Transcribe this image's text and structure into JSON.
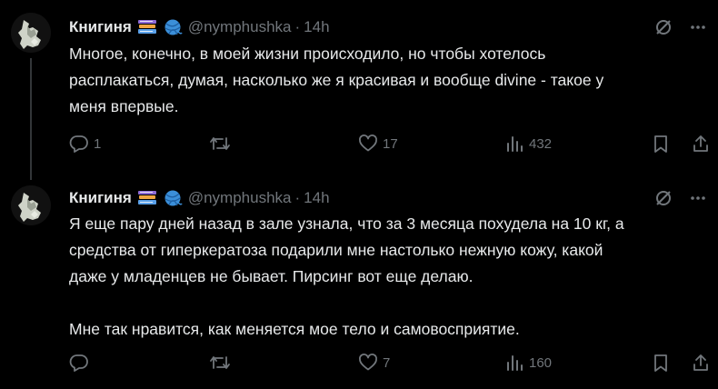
{
  "tweets": [
    {
      "name": "Книгиня",
      "emoji_icons": [
        "books-icon",
        "yarn-ball-icon"
      ],
      "handle": "@nymphushka",
      "separator": "·",
      "time": "14h",
      "text": "Многое, конечно, в моей жизни происходило, но чтобы хотелось\nрасплакаться, думая, насколько же я красивая и вообще divine - такое у\nменя впервые.",
      "actions": {
        "replies": "1",
        "retweets": "",
        "likes": "17",
        "views": "432"
      }
    },
    {
      "name": "Книгиня",
      "emoji_icons": [
        "books-icon",
        "yarn-ball-icon"
      ],
      "handle": "@nymphushka",
      "separator": "·",
      "time": "14h",
      "text": "Я еще пару дней назад в зале узнала, что за 3 месяца похудела на 10 кг, а\nсредства от гиперкератоза подарили мне настолько нежную кожу, какой\nдаже у младенцев не бывает. Пирсинг вот еще делаю.\n\nМне так нравится, как меняется мое тело и самовосприятие.",
      "actions": {
        "replies": "",
        "retweets": "",
        "likes": "7",
        "views": "160"
      }
    }
  ],
  "colors": {
    "background": "#000000",
    "text": "#e7e9ea",
    "muted": "#71767b",
    "thread_line": "#333639"
  }
}
